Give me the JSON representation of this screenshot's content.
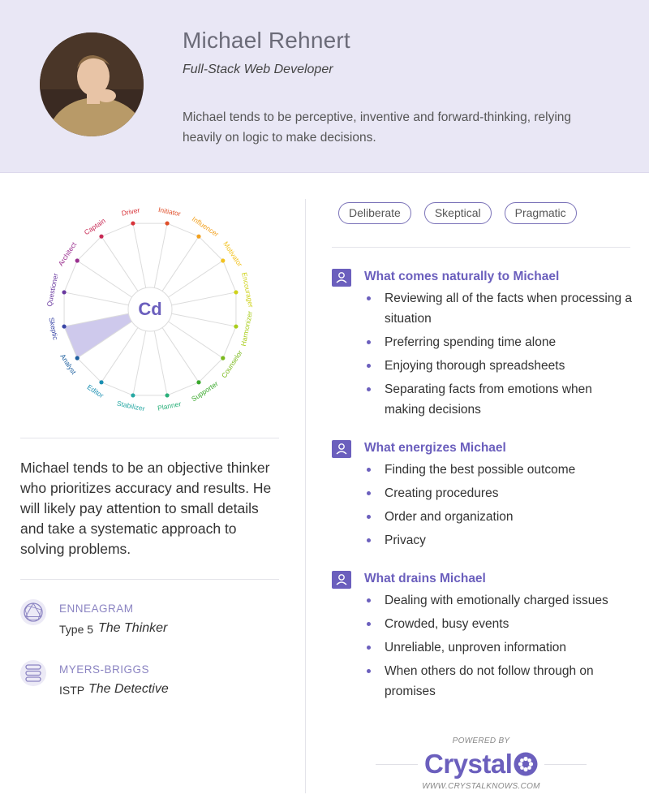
{
  "profile": {
    "name": "Michael Rehnert",
    "title": "Full-Stack Web Developer",
    "summary": "Michael tends to be perceptive, inventive and forward-thinking, relying heavily on logic to make decisions."
  },
  "disc_wheel": {
    "center_label": "Cd",
    "highlighted_segment": "Skeptic",
    "labels": [
      {
        "text": "Initiator",
        "color": "#e0502b"
      },
      {
        "text": "Influencer",
        "color": "#f2a11f"
      },
      {
        "text": "Motivator",
        "color": "#f2c21f"
      },
      {
        "text": "Encourager",
        "color": "#cfd21a"
      },
      {
        "text": "Harmonizer",
        "color": "#a9cd1c"
      },
      {
        "text": "Counselor",
        "color": "#7ab91c"
      },
      {
        "text": "Supporter",
        "color": "#3aa82c"
      },
      {
        "text": "Planner",
        "color": "#2ab07a"
      },
      {
        "text": "Stabilizer",
        "color": "#27a8a3"
      },
      {
        "text": "Editor",
        "color": "#1a8fb2"
      },
      {
        "text": "Analyst",
        "color": "#1c5e9e"
      },
      {
        "text": "Skeptic",
        "color": "#3a46a6"
      },
      {
        "text": "Questioner",
        "color": "#6a3aa0"
      },
      {
        "text": "Architect",
        "color": "#9a2f8f"
      },
      {
        "text": "Captain",
        "color": "#c82a55"
      },
      {
        "text": "Driver",
        "color": "#d8343a"
      }
    ]
  },
  "description": "Michael tends to be an objective thinker who prioritizes accuracy and results. He will likely pay attention to small details and take a systematic approach to solving problems.",
  "enneagram": {
    "label": "ENNEAGRAM",
    "code": "Type 5",
    "name": "The Thinker"
  },
  "myers_briggs": {
    "label": "MYERS-BRIGGS",
    "code": "ISTP",
    "name": "The Detective"
  },
  "traits": [
    "Deliberate",
    "Skeptical",
    "Pragmatic"
  ],
  "sections": [
    {
      "title": "What comes naturally to Michael",
      "items": [
        "Reviewing all of the facts when processing a situation",
        "Preferring spending time alone",
        "Enjoying thorough spreadsheets",
        "Separating facts from emotions when making decisions"
      ]
    },
    {
      "title": "What energizes Michael",
      "items": [
        "Finding the best possible outcome",
        "Creating procedures",
        "Order and organization",
        "Privacy"
      ]
    },
    {
      "title": "What drains Michael",
      "items": [
        "Dealing with emotionally charged issues",
        "Crowded, busy events",
        "Unreliable, unproven information",
        "When others do not follow through on promises"
      ]
    }
  ],
  "footer": {
    "powered_by": "POWERED BY",
    "brand": "Crystal",
    "url": "WWW.CRYSTALKNOWS.COM"
  },
  "colors": {
    "accent": "#6b5fbd",
    "header_bg": "#e9e7f5",
    "wheel_highlight": "#c9c3ea"
  }
}
